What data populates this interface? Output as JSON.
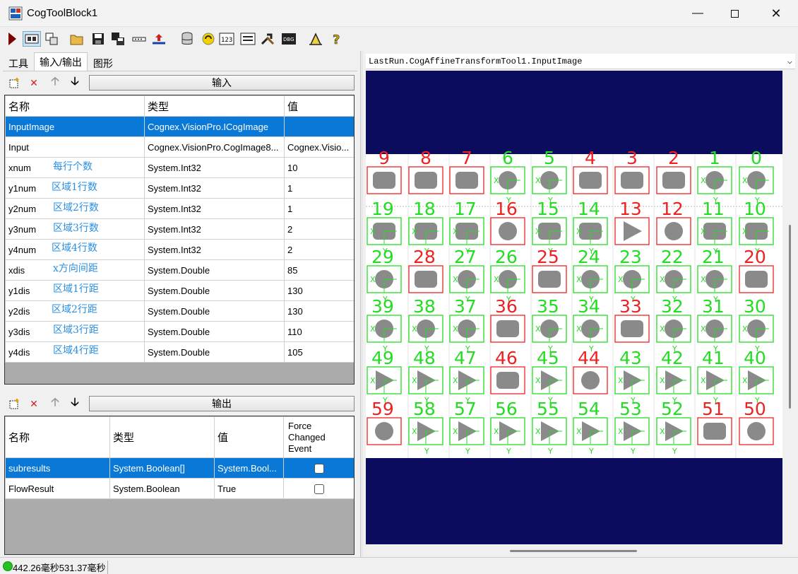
{
  "window": {
    "title": "CogToolBlock1"
  },
  "toolbar": {
    "icons": [
      "run-icon",
      "show-last-run-icon",
      "show-current-run-icon",
      "open-icon",
      "save-icon",
      "save-as-icon",
      "options-icon",
      "reset-icon",
      "database-icon",
      "refresh-icon",
      "number-format-icon",
      "display-icon",
      "tools-icon",
      "debug-icon",
      "graphics-icon",
      "help-icon"
    ]
  },
  "tabs": [
    {
      "label": "工具"
    },
    {
      "label": "输入/输出"
    },
    {
      "label": "图形"
    }
  ],
  "inputs": {
    "header": "输入",
    "columns": [
      "名称",
      "类型",
      "值"
    ],
    "rows": [
      {
        "name": "InputImage",
        "type": "Cognex.VisionPro.ICogImage",
        "value": "",
        "comment": ""
      },
      {
        "name": "Input",
        "type": "Cognex.VisionPro.CogImage8...",
        "value": "Cognex.Visio...",
        "comment": ""
      },
      {
        "name": "xnum",
        "type": "System.Int32",
        "value": "10",
        "comment": "每行个数"
      },
      {
        "name": "y1num",
        "type": "System.Int32",
        "value": "1",
        "comment": "区域1行数"
      },
      {
        "name": "y2num",
        "type": "System.Int32",
        "value": "1",
        "comment": "区域2行数"
      },
      {
        "name": "y3num",
        "type": "System.Int32",
        "value": "2",
        "comment": "区域3行数"
      },
      {
        "name": "y4num",
        "type": "System.Int32",
        "value": "2",
        "comment": "区域4行数"
      },
      {
        "name": "xdis",
        "type": "System.Double",
        "value": "85",
        "comment": "x方向间距"
      },
      {
        "name": "y1dis",
        "type": "System.Double",
        "value": "130",
        "comment": "区域1行距"
      },
      {
        "name": "y2dis",
        "type": "System.Double",
        "value": "130",
        "comment": "区域2行距"
      },
      {
        "name": "y3dis",
        "type": "System.Double",
        "value": "110",
        "comment": "区域3行距"
      },
      {
        "name": "y4dis",
        "type": "System.Double",
        "value": "105",
        "comment": "区域4行距"
      }
    ]
  },
  "outputs": {
    "header": "输出",
    "columns": [
      "名称",
      "类型",
      "值",
      "Force Changed Event"
    ],
    "rows": [
      {
        "name": "subresults",
        "type": "System.Boolean[]",
        "value": "System.Bool...",
        "force": false
      },
      {
        "name": "FlowResult",
        "type": "System.Boolean",
        "value": "True",
        "force": false
      }
    ]
  },
  "image": {
    "selector": "LastRun.CogAffineTransformTool1.InputImage",
    "numbers": [
      [
        9,
        8,
        7,
        6,
        5,
        4,
        3,
        2,
        1,
        0
      ],
      [
        19,
        18,
        17,
        16,
        15,
        14,
        13,
        12,
        11,
        10
      ],
      [
        29,
        28,
        27,
        26,
        25,
        24,
        23,
        22,
        21,
        20
      ],
      [
        39,
        38,
        37,
        36,
        35,
        34,
        33,
        32,
        31,
        30
      ],
      [
        49,
        48,
        47,
        46,
        45,
        44,
        43,
        42,
        41,
        40
      ],
      [
        59,
        58,
        57,
        56,
        55,
        54,
        53,
        52,
        51,
        50
      ]
    ],
    "shapes": [
      [
        "rect",
        "rect",
        "rect",
        "circle",
        "circle",
        "rect",
        "rect",
        "rect",
        "circle",
        "circle"
      ],
      [
        "rect",
        "rect",
        "rect",
        "circle",
        "rect",
        "rect",
        "triangle",
        "circle",
        "rect",
        "rect"
      ],
      [
        "circle",
        "rect",
        "circle",
        "circle",
        "rect",
        "circle",
        "circle",
        "circle",
        "circle",
        "rect"
      ],
      [
        "circle",
        "circle",
        "circle",
        "rect",
        "circle",
        "circle",
        "rect",
        "circle",
        "circle",
        "circle"
      ],
      [
        "triangle",
        "triangle",
        "triangle",
        "rect",
        "triangle",
        "circle",
        "triangle",
        "triangle",
        "triangle",
        "triangle"
      ],
      [
        "circle",
        "triangle",
        "triangle",
        "triangle",
        "triangle",
        "triangle",
        "triangle",
        "triangle",
        "rect",
        "circle"
      ]
    ],
    "fail": [
      [
        true,
        true,
        true,
        false,
        false,
        true,
        true,
        true,
        false,
        false
      ],
      [
        false,
        false,
        false,
        true,
        false,
        false,
        true,
        true,
        false,
        false
      ],
      [
        false,
        true,
        false,
        false,
        true,
        false,
        false,
        false,
        false,
        true
      ],
      [
        false,
        false,
        false,
        true,
        false,
        false,
        true,
        false,
        false,
        false
      ],
      [
        false,
        false,
        false,
        true,
        false,
        true,
        false,
        false,
        false,
        false
      ],
      [
        true,
        false,
        false,
        false,
        false,
        false,
        false,
        false,
        true,
        true
      ]
    ],
    "colors": {
      "pass": "#22dd22",
      "fail": "#ee2222",
      "background": "#0c0c5e",
      "plate": "#ffffff",
      "part": "#8a8a8a"
    }
  },
  "status": {
    "text": "442.26毫秒531.37毫秒",
    "color": "#22c322"
  }
}
